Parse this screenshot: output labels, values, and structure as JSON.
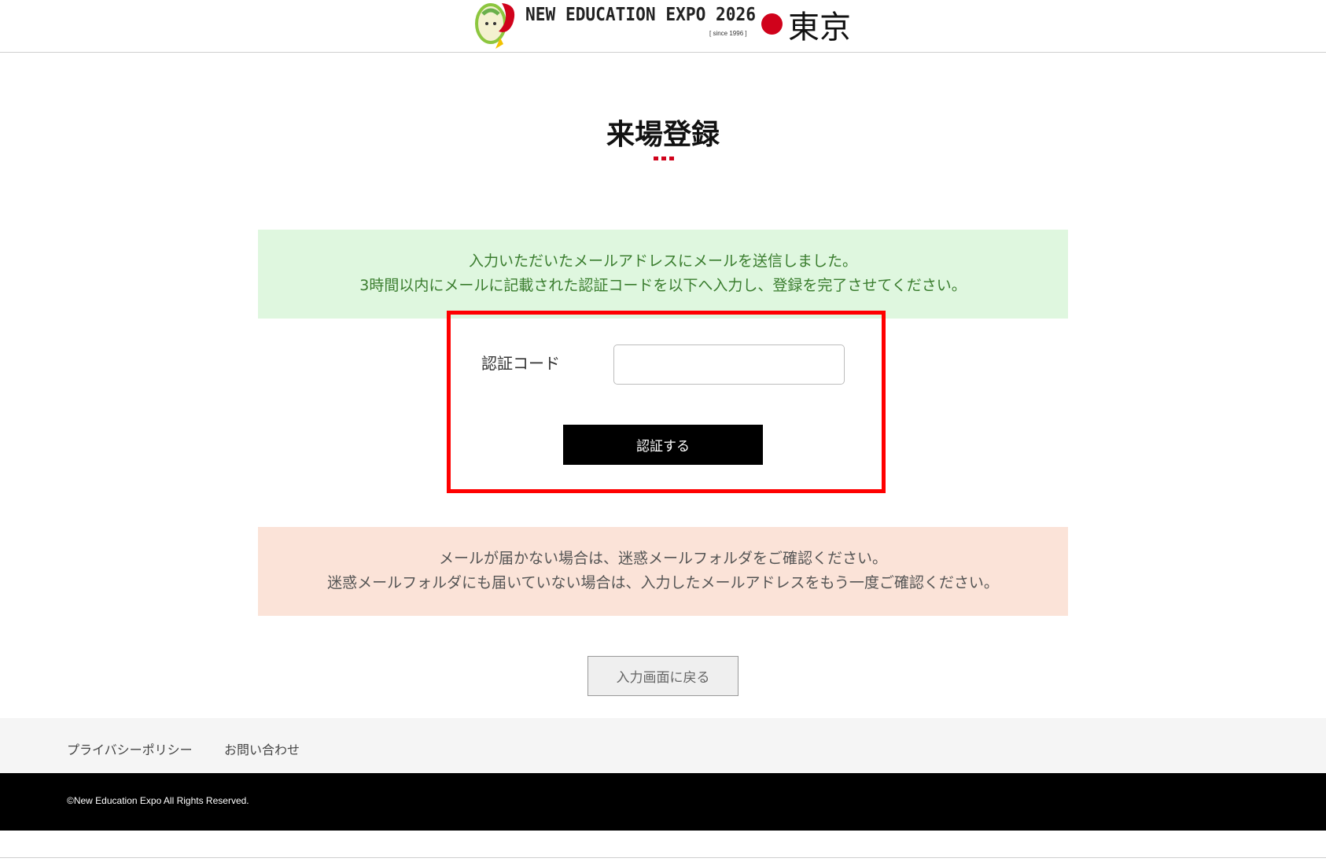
{
  "header": {
    "logo_text": "NEW EDUCATION EXPO 2026",
    "since_text": "[ since 1996 ]",
    "city": "東京",
    "accent_color": "#d0021b"
  },
  "main": {
    "title": "来場登録",
    "success_notice": {
      "line1": "入力いただいたメールアドレスにメールを送信しました。",
      "line2": "3時間以内にメールに記載された認証コードを以下へ入力し、登録を完了させてください。"
    },
    "form": {
      "code_label": "認証コード",
      "code_value": "",
      "code_placeholder": "",
      "verify_button": "認証する"
    },
    "warning_notice": {
      "line1": "メールが届かない場合は、迷惑メールフォルダをご確認ください。",
      "line2": "迷惑メールフォルダにも届いていない場合は、入力したメールアドレスをもう一度ご確認ください。"
    },
    "back_button": "入力画面に戻る"
  },
  "footer": {
    "links": [
      {
        "label": "プライバシーポリシー"
      },
      {
        "label": "お問い合わせ"
      }
    ],
    "copyright": "©New Education Expo All Rights Reserved."
  }
}
